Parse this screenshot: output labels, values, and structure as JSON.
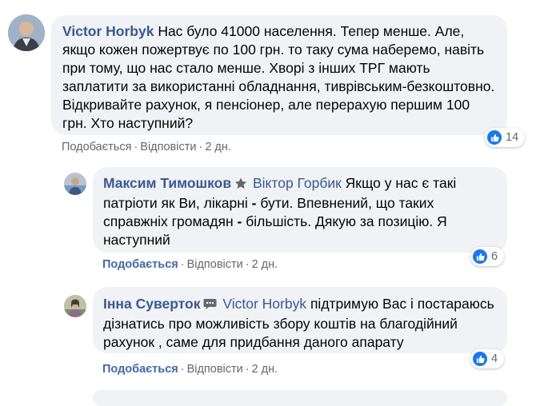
{
  "comments": [
    {
      "author": "Victor Horbyk",
      "text": "Нас було 41000 населення. Тепер менше. Але, якщо кожен пожертвує по 100 грн. то таку сума наберемо, навіть при тому, що нас стало менше. Хворі з інших ТРГ мають заплатити за використанні обладнання, тиврівським-безкоштовно. Відкривайте рахунок, я пенсіонер, але перерахую першим 100 грн. Хто наступний?",
      "like_label": "Подобається",
      "reply_label": "Відповісти",
      "time": "2 дн.",
      "reaction_count": "14"
    },
    {
      "author": "Максим Тимошков",
      "mention": "Віктор Горбик",
      "text_a": "Якщо у нас є такі патріоти як Ви, лікарні",
      "dash1": "-",
      "text_b": "бути. Впевнений, що таких справжніх громадян",
      "dash2": "-",
      "text_c": "більшість. Дякую за позицію. Я наступний",
      "like_label": "Подобається",
      "reply_label": "Відповісти",
      "time": "2 дн.",
      "reaction_count": "6"
    },
    {
      "author": "Інна Суверток",
      "mention": "Victor Horbyk",
      "text": "підтримую Вас і постараюсь дізнатись про можливість збору коштів на благодійний рахунок , саме для придбання даного апарату",
      "like_label": "Подобається",
      "reply_label": "Відповісти",
      "time": "2 дн.",
      "reaction_count": "4"
    }
  ],
  "separator": "·",
  "icons": {
    "like": "like-thumb-icon",
    "top_fan": "top-fan-badge-icon",
    "commenter_badge": "chat-badge-icon"
  },
  "colors": {
    "bubble": "#f0f2f5",
    "author": "#385898",
    "like_active": "#4267b2",
    "like_reaction": "#1877f2",
    "meta": "#65676b"
  }
}
